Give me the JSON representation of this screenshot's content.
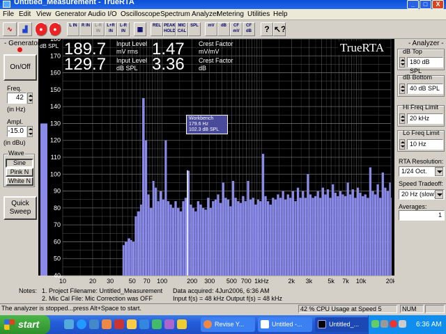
{
  "window": {
    "title": "Untitled_Measurement - TrueRTA",
    "minimize": "_",
    "maximize": "□",
    "close": "X"
  },
  "menu": [
    "File",
    "Edit",
    "View",
    "Generator",
    "Audio I/O",
    "Oscilloscope",
    "Spectrum Analyzer",
    "Metering",
    "Utilities",
    "Help"
  ],
  "toolbar": {
    "buttons": [
      "L IN",
      "R IN",
      "L-R IN",
      "L+R IN",
      "L-R IN",
      "REL",
      "PEAK HOLD",
      "MIC CAL",
      "SPL",
      "mV",
      "dB",
      "CF mV",
      "CF dB"
    ]
  },
  "generator": {
    "title": "- Generator -",
    "onoff": "On/Off",
    "freq_label": "Freq.",
    "freq_value": "42",
    "freq_unit": "(in Hz)",
    "ampl_label": "Ampl.",
    "ampl_value": "-15.0",
    "ampl_unit": "(in dBu)",
    "wave_label": "Wave",
    "waves": [
      "Sine",
      "Pink N",
      "White N"
    ],
    "quick_sweep": "Quick Sweep"
  },
  "analyzer": {
    "title": "- Analyzer -",
    "db_top_label": "dB Top",
    "db_top_value": "180 dB SPL",
    "db_bottom_label": "dB Bottom",
    "db_bottom_value": "40 dB SPL",
    "hi_freq_label": "Hi Freq Limit",
    "hi_freq_value": "20 kHz",
    "lo_freq_label": "Lo Freq Limit",
    "lo_freq_value": "10 Hz",
    "rta_res_label": "RTA Resolution:",
    "rta_res_value": "1/24 Oct.",
    "speed_label": "Speed Tradeoff:",
    "speed_value": "20 Hz (slow)",
    "averages_label": "Averages:",
    "averages_value": "1"
  },
  "readouts": {
    "v1": "189.7",
    "l1": "Input Level",
    "u1": "mV rms",
    "v2": "1.47",
    "l2": "Crest Factor",
    "u2": "mV/mV",
    "v3": "129.7",
    "l3": "Input Level",
    "u3": "dB SPL",
    "v4": "3.36",
    "l4": "Crest Factor",
    "u4": "dB",
    "logo": "TrueRTA",
    "units": "dB SPL"
  },
  "tooltip": {
    "line1": "Workbench",
    "line2": "179.6 Hz",
    "line3": "102.3 dB SPL"
  },
  "notes": {
    "label": "Notes:",
    "line1": "1. Project Filename: Untitled_Measurement",
    "line2": "2. Mic Cal File: Mic Correction was OFF",
    "acq": "Data acquired: 4Jun2006, 6:36 AM",
    "fs": "Input f(s) = 48 kHz   Output f(s) = 48 kHz"
  },
  "status": {
    "message": "The analyzer is stopped...press Alt+Space to start.",
    "cpu": "42 % CPU Usage at Speed 5",
    "num": "NUM"
  },
  "taskbar": {
    "start": "start",
    "items": [
      "Revise Y...",
      "Untitled -...",
      "Untitled_..."
    ],
    "clock": "6:36 AM"
  },
  "chart_data": {
    "type": "bar",
    "ylabel": "dB SPL",
    "xscale": "log",
    "xlim": [
      10,
      20000
    ],
    "ylim": [
      40,
      180
    ],
    "y_ticks": [
      40,
      50,
      60,
      70,
      80,
      90,
      100,
      110,
      120,
      130,
      140,
      150,
      160,
      170,
      180
    ],
    "x_ticks": [
      {
        "v": 10,
        "label": "10"
      },
      {
        "v": 20,
        "label": "20"
      },
      {
        "v": 30,
        "label": "30"
      },
      {
        "v": 50,
        "label": "50"
      },
      {
        "v": 70,
        "label": "70"
      },
      {
        "v": 100,
        "label": "100"
      },
      {
        "v": 200,
        "label": "200"
      },
      {
        "v": 300,
        "label": "300"
      },
      {
        "v": 500,
        "label": "500"
      },
      {
        "v": 700,
        "label": "700"
      },
      {
        "v": 1000,
        "label": "1kHz"
      },
      {
        "v": 2000,
        "label": "2k"
      },
      {
        "v": 3000,
        "label": "3k"
      },
      {
        "v": 5000,
        "label": "5k"
      },
      {
        "v": 7000,
        "label": "7k"
      },
      {
        "v": 10000,
        "label": "10k"
      },
      {
        "v": 20000,
        "label": "20k"
      }
    ],
    "level_bar_value": 130,
    "cursor_freq": 179.6,
    "spectrum_freqs": [
      40,
      42,
      45,
      48,
      50,
      53,
      56,
      60,
      63,
      67,
      71,
      75,
      80,
      84,
      89,
      94,
      100,
      106,
      112,
      119,
      126,
      133,
      141,
      150,
      159,
      168,
      179.6,
      190,
      200,
      212,
      224,
      238,
      252,
      267,
      283,
      300,
      317,
      336,
      356,
      377,
      400,
      424,
      449,
      476,
      504,
      534,
      566,
      600,
      635,
      673,
      713,
      755,
      800,
      848,
      898,
      951,
      1008,
      1068,
      1131,
      1198,
      1270,
      1345,
      1425,
      1510,
      1600,
      1695,
      1795,
      1902,
      2015,
      2135,
      2262,
      2396,
      2539,
      2690,
      2850,
      3019,
      3199,
      3389,
      3590,
      3804,
      4030,
      4270,
      4524,
      4793,
      5078,
      5380,
      5700,
      6039,
      6398,
      6779,
      7182,
      7609,
      8061,
      8541,
      9049,
      9587,
      10157,
      10761,
      11401,
      12079,
      12797,
      13558,
      14364,
      15218,
      16123,
      17082,
      18097,
      19173,
      19999
    ],
    "spectrum_levels": [
      58,
      60,
      62,
      61,
      60,
      75,
      78,
      82,
      145,
      120,
      88,
      80,
      96,
      92,
      84,
      90,
      85,
      120,
      84,
      82,
      80,
      84,
      80,
      78,
      84,
      86,
      102,
      82,
      80,
      78,
      84,
      82,
      80,
      79,
      86,
      80,
      84,
      85,
      88,
      83,
      95,
      86,
      85,
      81,
      96,
      86,
      84,
      83,
      87,
      84,
      96,
      85,
      86,
      82,
      85,
      84,
      112,
      87,
      84,
      82,
      86,
      85,
      88,
      86,
      90,
      85,
      88,
      86,
      90,
      84,
      92,
      86,
      90,
      86,
      100,
      88,
      86,
      87,
      90,
      86,
      92,
      88,
      91,
      86,
      94,
      89,
      87,
      90,
      88,
      87,
      95,
      88,
      91,
      86,
      92,
      89,
      87,
      88,
      86,
      104,
      90,
      88,
      94,
      86,
      101,
      92,
      90,
      95,
      86
    ]
  }
}
